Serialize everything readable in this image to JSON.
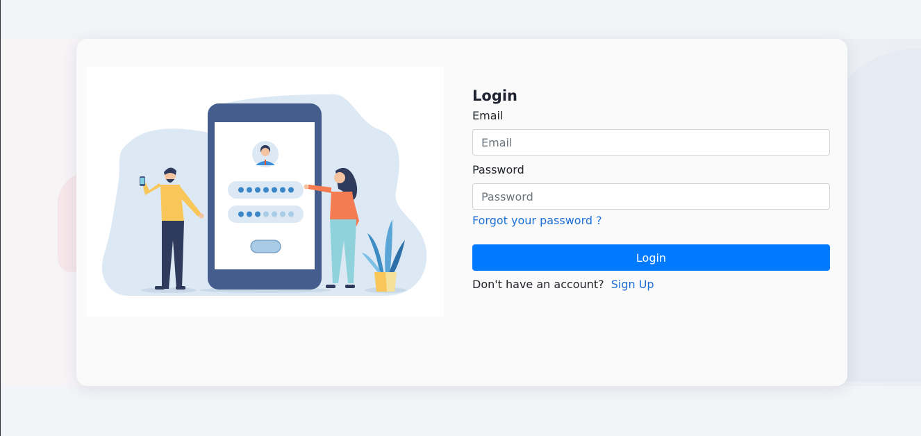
{
  "login": {
    "title": "Login",
    "email_label": "Email",
    "email_placeholder": "Email",
    "email_value": "",
    "password_label": "Password",
    "password_placeholder": "Password",
    "password_value": "",
    "forgot_link": "Forgot your password ?",
    "submit_label": "Login",
    "no_account_text": "Don't have an account?",
    "signup_link": "Sign Up"
  },
  "illustration": {
    "icon": "login-illustration-icon"
  },
  "colors": {
    "primary": "#007bff",
    "link": "#1a6fd8",
    "text": "#212529",
    "card_background": "#fafafb",
    "page_background": "#f3f4f8"
  }
}
